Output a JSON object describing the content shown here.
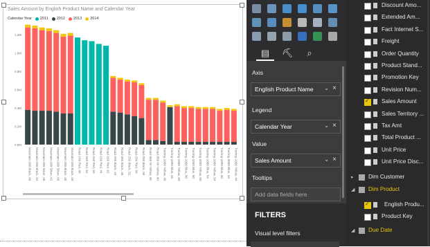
{
  "chart": {
    "title": "Sales Amount by English Product Name and Calendar Year",
    "legend_title": "Calendar Year",
    "legend": [
      {
        "label": "2011",
        "color": "#00b8aa"
      },
      {
        "label": "2012",
        "color": "#374649"
      },
      {
        "label": "2013",
        "color": "#fd625e"
      },
      {
        "label": "2014",
        "color": "#f2c80f"
      }
    ]
  },
  "chart_data": {
    "type": "bar",
    "stacked": true,
    "title": "Sales Amount by English Product Name and Calendar Year",
    "ytick_labels": [
      "0.0M",
      "0.2M",
      "0.4M",
      "0.6M",
      "0.8M",
      "1.0M",
      "1.2M"
    ],
    "ylim": [
      0,
      1.3
    ],
    "categories": [
      "Mountain-200 Black, 46",
      "Mountain-200 Black, 42",
      "Mountain-200 Silver, 38",
      "Mountain-200 Silver, 42",
      "Mountain-200 Silver, 46",
      "Mountain-200 Black, 38",
      "Mountain-200 Black, 46",
      "Road-150 Red, 48",
      "Road-150 Red, 52",
      "Road-150 Red, 56",
      "Road-150 Red, 44",
      "Road-150 Red, 62",
      "Road-250 Black, 44",
      "Road-250 Black, 48",
      "Road-250 Black, 52",
      "Road-250 Red, 58",
      "Road-250 Black, 58",
      "Road-350-W Yellow, 48",
      "Road-350-W Yellow, 40",
      "Touring-1000 Yellow, 46",
      "Touring-1000 Blue, 46",
      "Touring-1000 Yellow, 60",
      "Touring-1000 Blue, 50",
      "Touring-1000 Blue, 60",
      "Touring-1000 Yellow, 50",
      "Touring-1000 Blue, 54",
      "Touring-1000 Yellow, 54",
      "Touring-1000 Blue, 50",
      "Touring-3000 Blue, 44",
      "Touring-1000 Yellow, 44"
    ],
    "series": [
      {
        "name": "2011",
        "values": [
          0,
          0,
          0,
          0,
          0,
          0,
          0,
          1.17,
          1.14,
          1.13,
          1.1,
          1.08,
          0,
          0,
          0,
          0,
          0,
          0,
          0,
          0,
          0,
          0,
          0,
          0,
          0,
          0,
          0,
          0,
          0,
          0
        ]
      },
      {
        "name": "2012",
        "values": [
          0.38,
          0.37,
          0.37,
          0.37,
          0.36,
          0.34,
          0.34,
          0,
          0,
          0,
          0,
          0,
          0.36,
          0.35,
          0.33,
          0.31,
          0.29,
          0.05,
          0.05,
          0.04,
          0.41,
          0.03,
          0.03,
          0.03,
          0.03,
          0.03,
          0.03,
          0.03,
          0.03,
          0.03
        ]
      },
      {
        "name": "2013",
        "values": [
          0.9,
          0.9,
          0.88,
          0.87,
          0.86,
          0.84,
          0.85,
          0,
          0,
          0,
          0,
          0,
          0.37,
          0.36,
          0.36,
          0.37,
          0.36,
          0.44,
          0.44,
          0.42,
          0,
          0.39,
          0.37,
          0.37,
          0.36,
          0.36,
          0.36,
          0.34,
          0.35,
          0.34
        ]
      },
      {
        "name": "2014",
        "values": [
          0.03,
          0.03,
          0.03,
          0.03,
          0.03,
          0.03,
          0.03,
          0,
          0,
          0,
          0,
          0,
          0.02,
          0.02,
          0.02,
          0.02,
          0.02,
          0.02,
          0.02,
          0.02,
          0.02,
          0.02,
          0.02,
          0.02,
          0.02,
          0.02,
          0.02,
          0.02,
          0.02,
          0.02
        ]
      }
    ],
    "colors": [
      "#00b8aa",
      "#374649",
      "#fd625e",
      "#f2c80f"
    ]
  },
  "viz_icons": [
    {
      "name": "matrix-icon",
      "color": "#8a9fb8"
    },
    {
      "name": "scatter-icon",
      "color": "#7aa7d6"
    },
    {
      "name": "pie-icon",
      "color": "#4f9fe0"
    },
    {
      "name": "donut-icon",
      "color": "#4aa0e8"
    },
    {
      "name": "treemap-icon",
      "color": "#5aa0d8"
    },
    {
      "name": "map-icon",
      "color": "#5fa8e0"
    },
    {
      "name": "filled-map-icon",
      "color": "#6aa6d0"
    },
    {
      "name": "funnel-icon",
      "color": "#5f9fd9"
    },
    {
      "name": "gauge-icon",
      "color": "#e0a030"
    },
    {
      "name": "card-icon",
      "color": "#d0d0d0"
    },
    {
      "name": "multirow-card-icon",
      "color": "#b8c8d8"
    },
    {
      "name": "kpi-icon",
      "color": "#6fa0c8"
    },
    {
      "name": "slicer-icon",
      "color": "#9ab0c8"
    },
    {
      "name": "table-icon",
      "color": "#a8b8c8"
    },
    {
      "name": "matrix2-icon",
      "color": "#a0b0c0"
    },
    {
      "name": "r-visual-icon",
      "color": "#3a7bd5"
    },
    {
      "name": "globe-icon",
      "color": "#36a45a"
    },
    {
      "name": "more-icon",
      "color": "#c0c0c0"
    }
  ],
  "wells": {
    "axis_label": "Axis",
    "axis_value": "English Product Name",
    "legend_label": "Legend",
    "legend_value": "Calendar Year",
    "value_label": "Value",
    "value_value": "Sales Amount",
    "tooltips_label": "Tooltips",
    "tooltips_placeholder": "Add data fields here"
  },
  "filters": {
    "header": "FILTERS",
    "visual_level": "Visual level filters"
  },
  "field_list": {
    "fields": [
      {
        "label": "Discount Amo...",
        "checked": false
      },
      {
        "label": "Extended Am...",
        "checked": false
      },
      {
        "label": "Fact Internet S...",
        "checked": false
      },
      {
        "label": "Freight",
        "checked": false
      },
      {
        "label": "Order Quantity",
        "checked": false
      },
      {
        "label": "Product Stand...",
        "checked": false
      },
      {
        "label": "Promotion Key",
        "checked": false
      },
      {
        "label": "Revision Num...",
        "checked": false
      },
      {
        "label": "Sales Amount",
        "checked": true
      },
      {
        "label": "Sales Territory ...",
        "checked": false
      },
      {
        "label": "Tax Amt",
        "checked": false
      },
      {
        "label": "Total Product ...",
        "checked": false
      },
      {
        "label": "Unit Price",
        "checked": false
      },
      {
        "label": "Unit Price Disc...",
        "checked": false
      }
    ],
    "dim_customer": "Dim Customer",
    "dim_product": "Dim Product",
    "product_fields": [
      {
        "label": "English Produ...",
        "checked": true
      },
      {
        "label": "Product Key",
        "checked": false
      }
    ],
    "due_date": "Due Date"
  }
}
